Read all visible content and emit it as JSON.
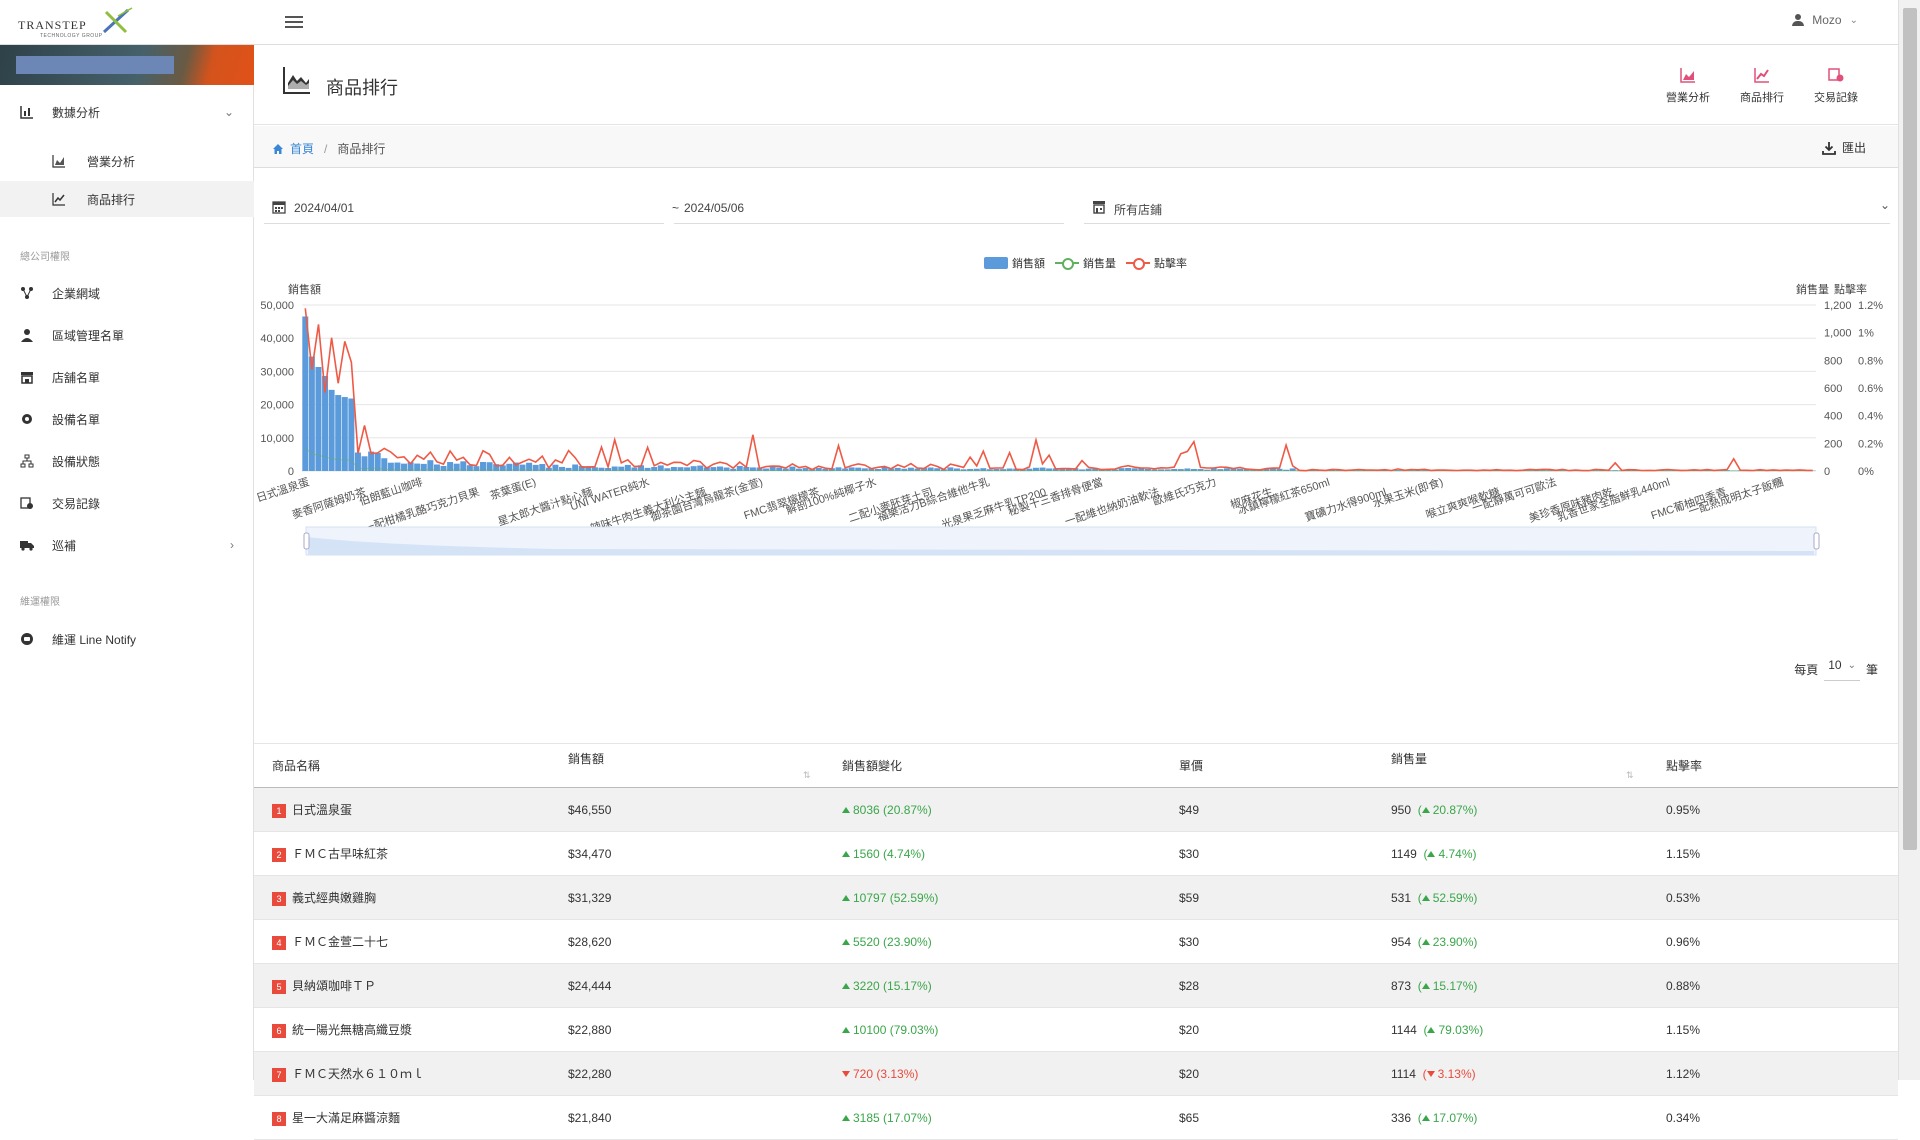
{
  "topbar": {
    "logo_text": "TRANSTEP",
    "logo_sub": "TECHNOLOGY GROUP",
    "user_name": "Mozo"
  },
  "sidebar": {
    "groups": [
      {
        "label": "數據分析",
        "expanded": true,
        "children": [
          {
            "label": "營業分析",
            "icon": "area-chart-icon"
          },
          {
            "label": "商品排行",
            "icon": "line-chart-icon",
            "active": true
          }
        ]
      }
    ],
    "section_company": "總公司權限",
    "company_items": [
      {
        "label": "企業網域",
        "icon": "network-icon"
      },
      {
        "label": "區域管理名單",
        "icon": "user-tie-icon"
      },
      {
        "label": "店舖名單",
        "icon": "store-icon"
      },
      {
        "label": "設備名單",
        "icon": "gear-icon"
      },
      {
        "label": "設備狀態",
        "icon": "sitemap-icon"
      },
      {
        "label": "交易記錄",
        "icon": "receipt-icon"
      },
      {
        "label": "巡補",
        "icon": "truck-icon",
        "has_children": true
      }
    ],
    "section_maint": "維運權限",
    "maint_items": [
      {
        "label": "維運 Line Notify",
        "icon": "line-icon"
      }
    ]
  },
  "page": {
    "title": "商品排行",
    "quick_links": [
      "營業分析",
      "商品排行",
      "交易記錄"
    ],
    "breadcrumb_home": "首頁",
    "breadcrumb_current": "商品排行",
    "export_label": "匯出"
  },
  "filters": {
    "date_from": "2024/04/01",
    "date_sep": "~",
    "date_to": "2024/05/06",
    "store": "所有店鋪"
  },
  "chart_data": {
    "type": "bar",
    "legend": [
      "銷售額",
      "銷售量",
      "點擊率"
    ],
    "y_left_label": "銷售額",
    "y_right_label_1": "銷售量",
    "y_right_label_2": "點擊率",
    "y_left_ticks": [
      "50,000",
      "40,000",
      "30,000",
      "20,000",
      "10,000",
      "0"
    ],
    "y_right_ticks_1": [
      "1,200",
      "1,000",
      "800",
      "600",
      "400",
      "200",
      "0"
    ],
    "y_right_ticks_2": [
      "1.2%",
      "1%",
      "0.8%",
      "0.6%",
      "0.4%",
      "0.2%",
      "0%"
    ],
    "ylim_left": [
      0,
      50000
    ],
    "ylim_right_qty": [
      0,
      1200
    ],
    "ylim_right_rate": [
      0,
      1.2
    ],
    "x_labels": [
      "日式溫泉蛋",
      "麥香阿薩姆奶茶",
      "伯朗藍山咖啡",
      "一配柑橘乳酪巧克力貝果",
      "茶葉蛋(E)",
      "星太郎大醬汁點心麵",
      "UNI WATER純水",
      "辣味牛肉生義大利公主麵",
      "御茶園台灣烏龍茶(金萱)",
      "FMC翡翠檸檬茶",
      "解剖100%純椰子水",
      "二配小麥胚芽土司",
      "福樂活力B綜合維他牛乳",
      "光泉果乏麻牛乳TP200",
      "秘製十三香排骨便當",
      "一配維也納奶油軟法",
      "歐維氏巧克力",
      "椒麻花生",
      "冰鎮檸檬紅茶650ml",
      "寶礦力水得900ml",
      "水果玉米(即食)",
      "喉立爽爽喉軟糖",
      "一配靜萬可可歐法",
      "美珍香原味豬肉乾",
      "乳香世家全脂鮮乳440ml",
      "FMC葡柚四季青",
      "一配熱成明太子飯糰"
    ],
    "sales_top": [
      46550,
      34470,
      31329,
      28620,
      24444,
      22880,
      22280,
      21840
    ],
    "note_series": "long-tail distribution of ~200 products"
  },
  "pagination": {
    "prefix": "每頁",
    "size": "10",
    "suffix": "筆"
  },
  "table": {
    "headers": [
      "商品名稱",
      "銷售額",
      "銷售額變化",
      "單價",
      "銷售量",
      "點擊率"
    ],
    "rows": [
      {
        "rank": "1",
        "name": "日式溫泉蛋",
        "sales": "$46,550",
        "change": "8036 (20.87%)",
        "dir": "up",
        "price": "$49",
        "qty": "950",
        "qty_change": "20.87%",
        "rate": "0.95%"
      },
      {
        "rank": "2",
        "name": "ＦＭＣ古早味紅茶",
        "sales": "$34,470",
        "change": "1560 (4.74%)",
        "dir": "up",
        "price": "$30",
        "qty": "1149",
        "qty_change": "4.74%",
        "rate": "1.15%"
      },
      {
        "rank": "3",
        "name": "義式經典嫩雞胸",
        "sales": "$31,329",
        "change": "10797 (52.59%)",
        "dir": "up",
        "price": "$59",
        "qty": "531",
        "qty_change": "52.59%",
        "rate": "0.53%"
      },
      {
        "rank": "4",
        "name": "ＦＭＣ金萱二十七",
        "sales": "$28,620",
        "change": "5520 (23.90%)",
        "dir": "up",
        "price": "$30",
        "qty": "954",
        "qty_change": "23.90%",
        "rate": "0.96%"
      },
      {
        "rank": "5",
        "name": "貝納頌咖啡ＴＰ",
        "sales": "$24,444",
        "change": "3220 (15.17%)",
        "dir": "up",
        "price": "$28",
        "qty": "873",
        "qty_change": "15.17%",
        "rate": "0.88%"
      },
      {
        "rank": "6",
        "name": "統一陽光無糖高纖豆漿",
        "sales": "$22,880",
        "change": "10100 (79.03%)",
        "dir": "up",
        "price": "$20",
        "qty": "1144",
        "qty_change": "79.03%",
        "rate": "1.15%"
      },
      {
        "rank": "7",
        "name": "ＦＭＣ天然水６１０ｍｌ",
        "sales": "$22,280",
        "change": "720 (3.13%)",
        "dir": "down",
        "price": "$20",
        "qty": "1114",
        "qty_change": "3.13%",
        "rate": "1.12%"
      },
      {
        "rank": "8",
        "name": "星一大滿足麻醬涼麵",
        "sales": "$21,840",
        "change": "3185 (17.07%)",
        "dir": "up",
        "price": "$65",
        "qty": "336",
        "qty_change": "17.07%",
        "rate": "0.34%"
      }
    ]
  }
}
